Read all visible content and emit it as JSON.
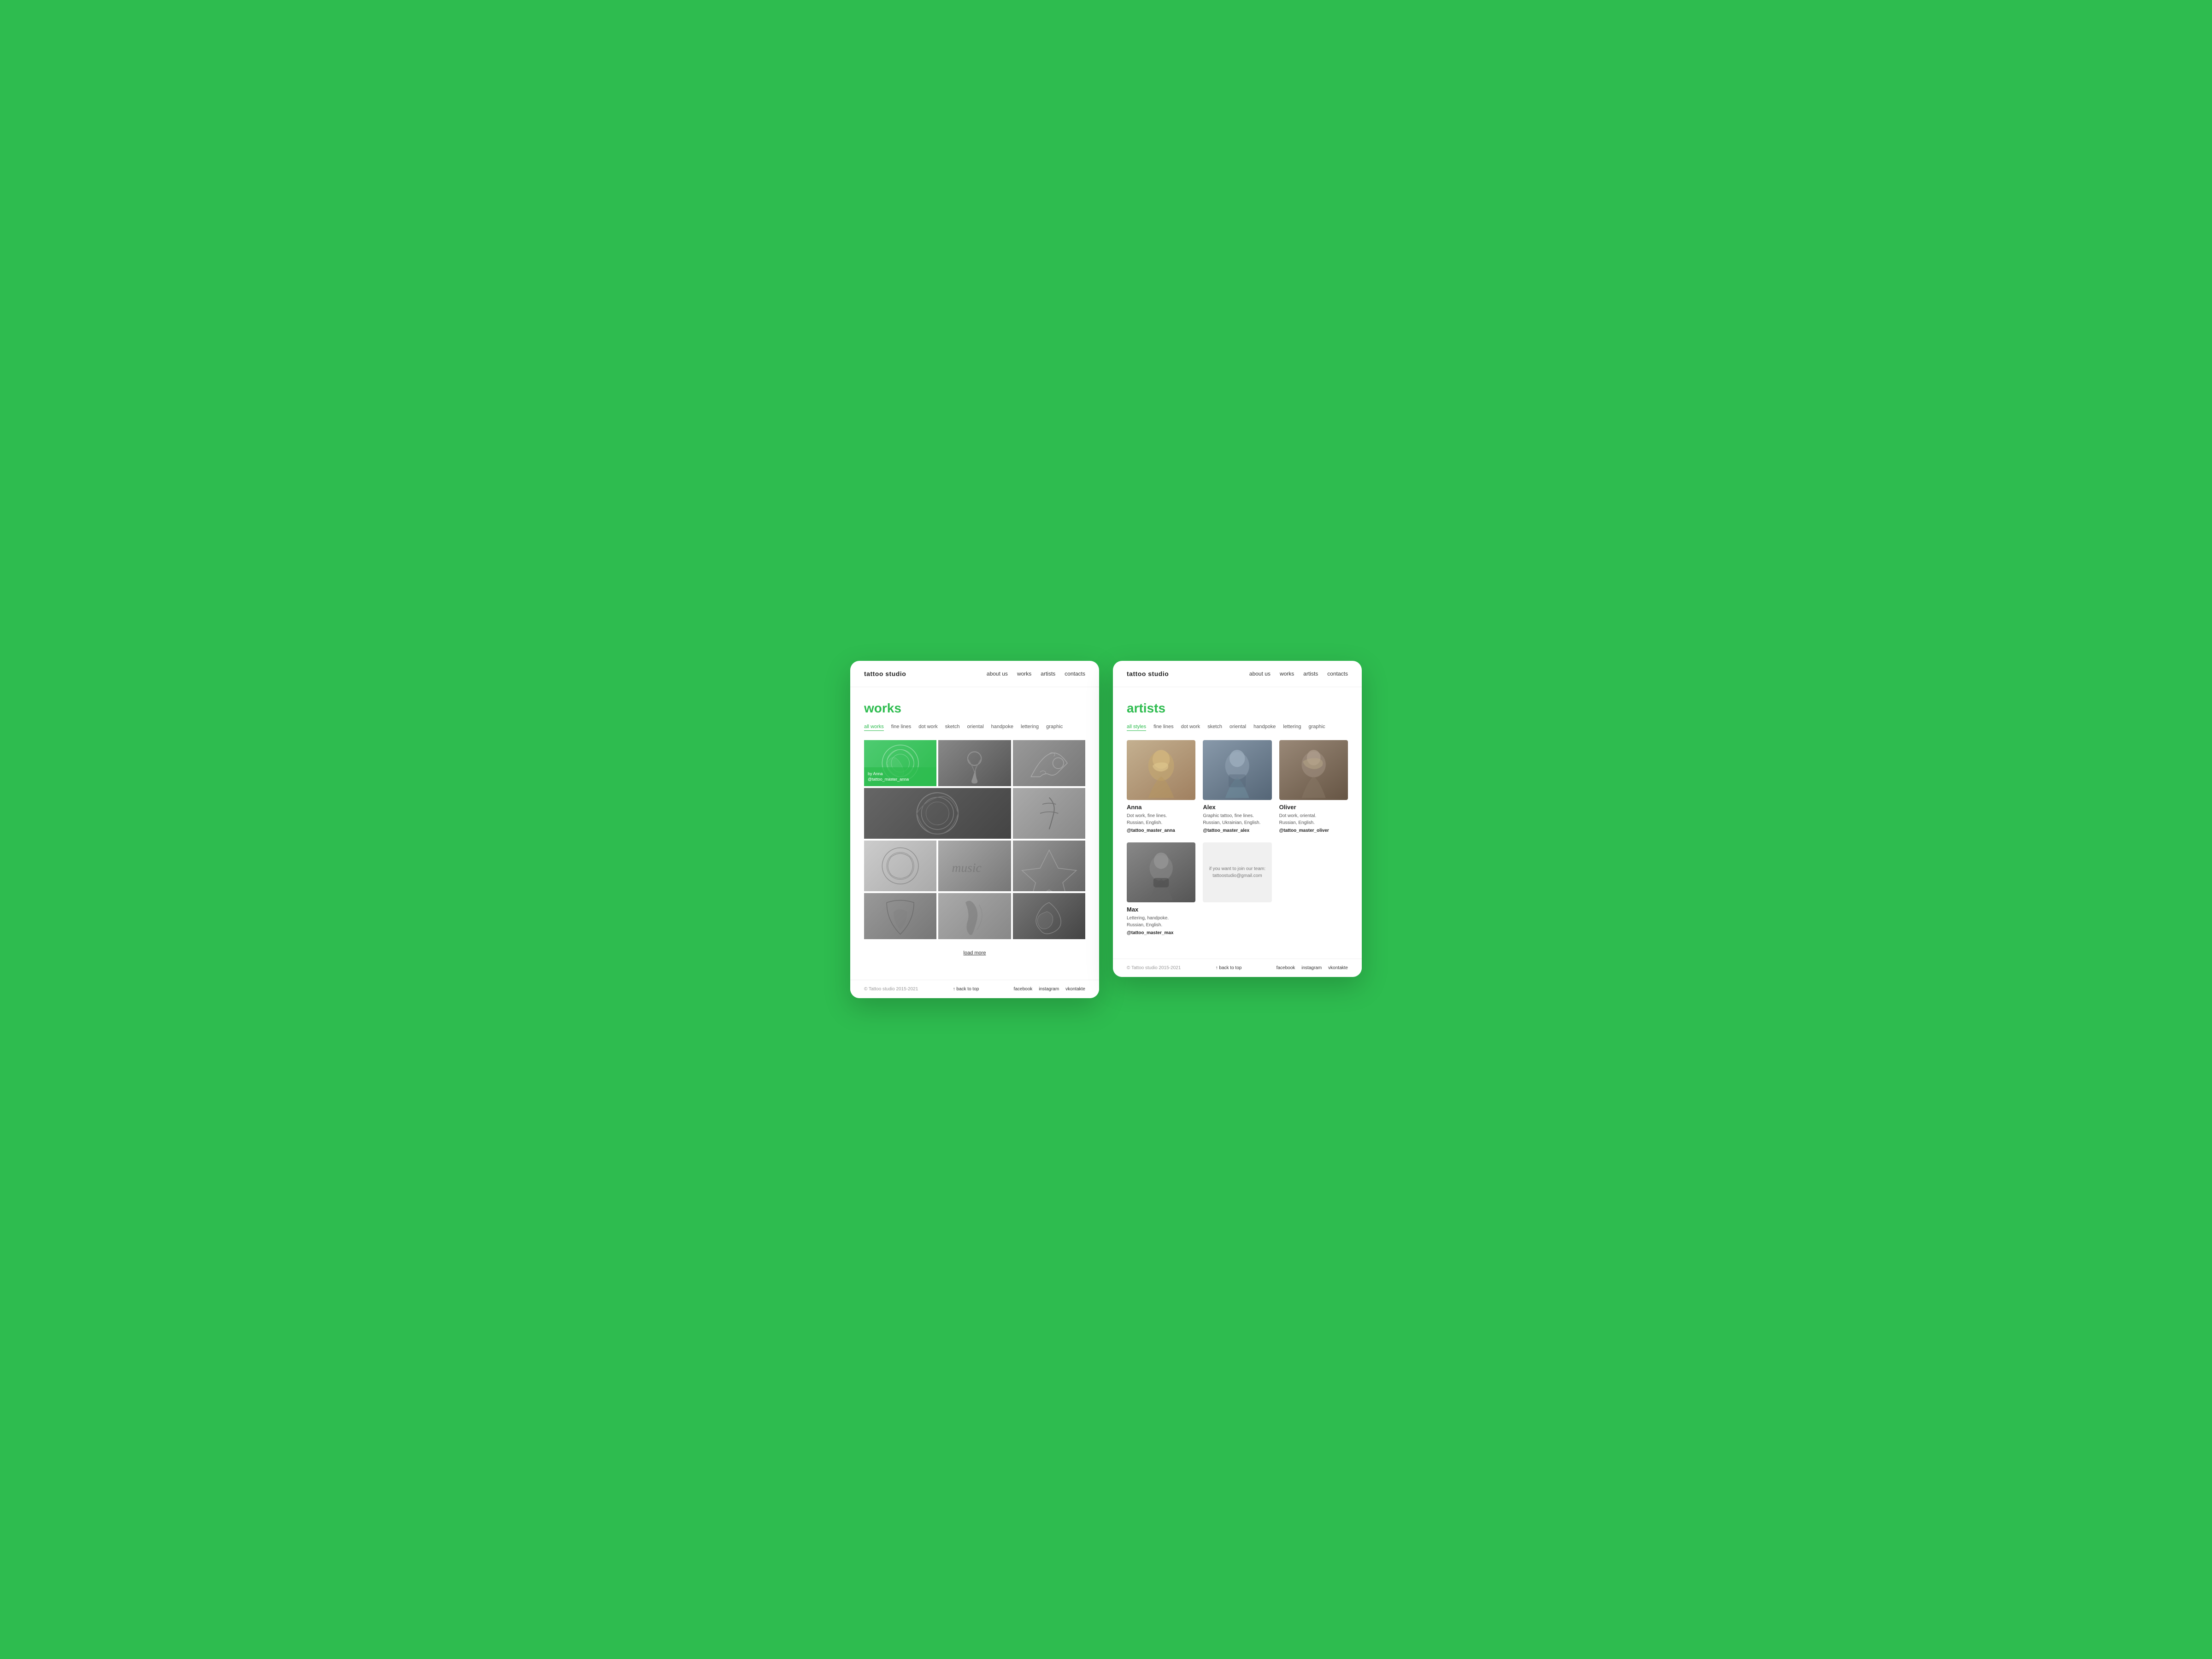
{
  "left_window": {
    "nav": {
      "logo": "tattoo studio",
      "links": [
        "about us",
        "works",
        "artists",
        "contacts"
      ]
    },
    "page_title": "works",
    "filters": {
      "items": [
        {
          "label": "all works",
          "active": true
        },
        {
          "label": "fine lines",
          "active": false
        },
        {
          "label": "dot work",
          "active": false
        },
        {
          "label": "sketch",
          "active": false
        },
        {
          "label": "oriental",
          "active": false
        },
        {
          "label": "handpoke",
          "active": false
        },
        {
          "label": "lettering",
          "active": false
        },
        {
          "label": "graphic",
          "active": false
        }
      ]
    },
    "gallery": {
      "items": [
        {
          "type": "green",
          "label": "by Anna\n@tattoo_master_anna",
          "has_overlay": true
        },
        {
          "type": "dark",
          "label": "",
          "has_overlay": false
        },
        {
          "type": "gray",
          "label": "",
          "has_overlay": false
        },
        {
          "type": "dark2",
          "label": "",
          "has_overlay": false
        },
        {
          "type": "gray2",
          "label": "",
          "has_overlay": false
        },
        {
          "type": "gray3",
          "label": "",
          "has_overlay": false
        },
        {
          "type": "light",
          "label": "",
          "has_overlay": false
        },
        {
          "type": "light2",
          "label": "",
          "has_overlay": false
        },
        {
          "type": "dark3",
          "label": "",
          "has_overlay": false
        },
        {
          "type": "gray4",
          "label": "",
          "has_overlay": false
        },
        {
          "type": "dark4",
          "label": "",
          "has_overlay": false
        },
        {
          "type": "dark5",
          "label": "",
          "has_overlay": false
        }
      ]
    },
    "load_more": "load more",
    "footer": {
      "copyright": "© Tattoo studio 2015-2021",
      "back_to_top": "↑  back to top",
      "social": [
        "facebook",
        "instagram",
        "vkontakte"
      ]
    }
  },
  "right_window": {
    "nav": {
      "logo": "tattoo studio",
      "links": [
        "about us",
        "works",
        "artists",
        "contacts"
      ]
    },
    "page_title": "artists",
    "filters": {
      "items": [
        {
          "label": "all styles",
          "active": true
        },
        {
          "label": "fine lines",
          "active": false
        },
        {
          "label": "dot work",
          "active": false
        },
        {
          "label": "sketch",
          "active": false
        },
        {
          "label": "oriental",
          "active": false
        },
        {
          "label": "handpoke",
          "active": false
        },
        {
          "label": "lettering",
          "active": false
        },
        {
          "label": "graphic",
          "active": false
        }
      ]
    },
    "artists_top": [
      {
        "name": "Anna",
        "description": "Dot work, fine lines.\nRussian, English.",
        "handle": "@tattoo_master_anna",
        "photo_type": "artist1"
      },
      {
        "name": "Alex",
        "description": "Graphic tattoo, fine lines.\nRussian, Ukrainian, English.",
        "handle": "@tattoo_master_alex",
        "photo_type": "artist2"
      },
      {
        "name": "Oliver",
        "description": "Dot work, oriental.\nRussian, English.",
        "handle": "@tattoo_master_oliver",
        "photo_type": "artist3"
      }
    ],
    "artists_bottom": [
      {
        "name": "Max",
        "description": "Lettering, handpoke.\nRussian, English.",
        "handle": "@tattoo_master_max",
        "photo_type": "artist4"
      }
    ],
    "join_text": "if you want to join our team:\ntattoostudio@gmail.com",
    "footer": {
      "copyright": "© Tattoo studio 2015-2021",
      "back_to_top": "↑  back to top",
      "social": [
        "facebook",
        "instagram",
        "vkontakte"
      ]
    }
  }
}
